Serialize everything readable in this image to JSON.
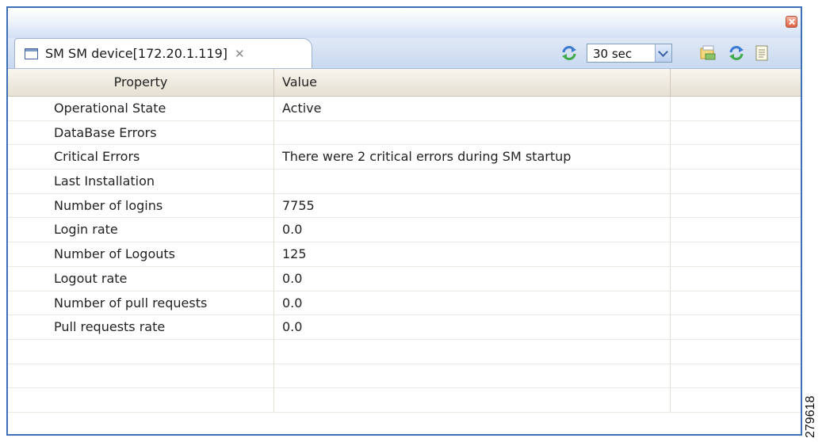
{
  "window": {
    "close_icon": "close-icon",
    "accent_color": "#3d6fb8"
  },
  "tab": {
    "label": "SM SM device[172.20.1.119]",
    "close_glyph": "✕",
    "icon": "document-icon"
  },
  "toolbar": {
    "refresh_interval": "30 sec",
    "icons": [
      "refresh-icon",
      "chevron-down-icon",
      "export-icon",
      "refresh-icon",
      "document-icon"
    ]
  },
  "table": {
    "columns": [
      "Property",
      "Value",
      ""
    ],
    "rows": [
      {
        "property": "Operational State",
        "value": "Active"
      },
      {
        "property": "DataBase Errors",
        "value": ""
      },
      {
        "property": "Critical Errors",
        "value": "There were 2 critical errors during SM startup"
      },
      {
        "property": "Last Installation",
        "value": ""
      },
      {
        "property": "Number of logins",
        "value": "7755"
      },
      {
        "property": "Login rate",
        "value": "0.0"
      },
      {
        "property": "Number of Logouts",
        "value": "125"
      },
      {
        "property": "Logout rate",
        "value": "0.0"
      },
      {
        "property": "Number of pull requests",
        "value": "0.0"
      },
      {
        "property": "Pull requests rate",
        "value": "0.0"
      },
      {
        "property": "",
        "value": ""
      },
      {
        "property": "",
        "value": ""
      },
      {
        "property": "",
        "value": ""
      }
    ]
  },
  "figure_number": "279618"
}
